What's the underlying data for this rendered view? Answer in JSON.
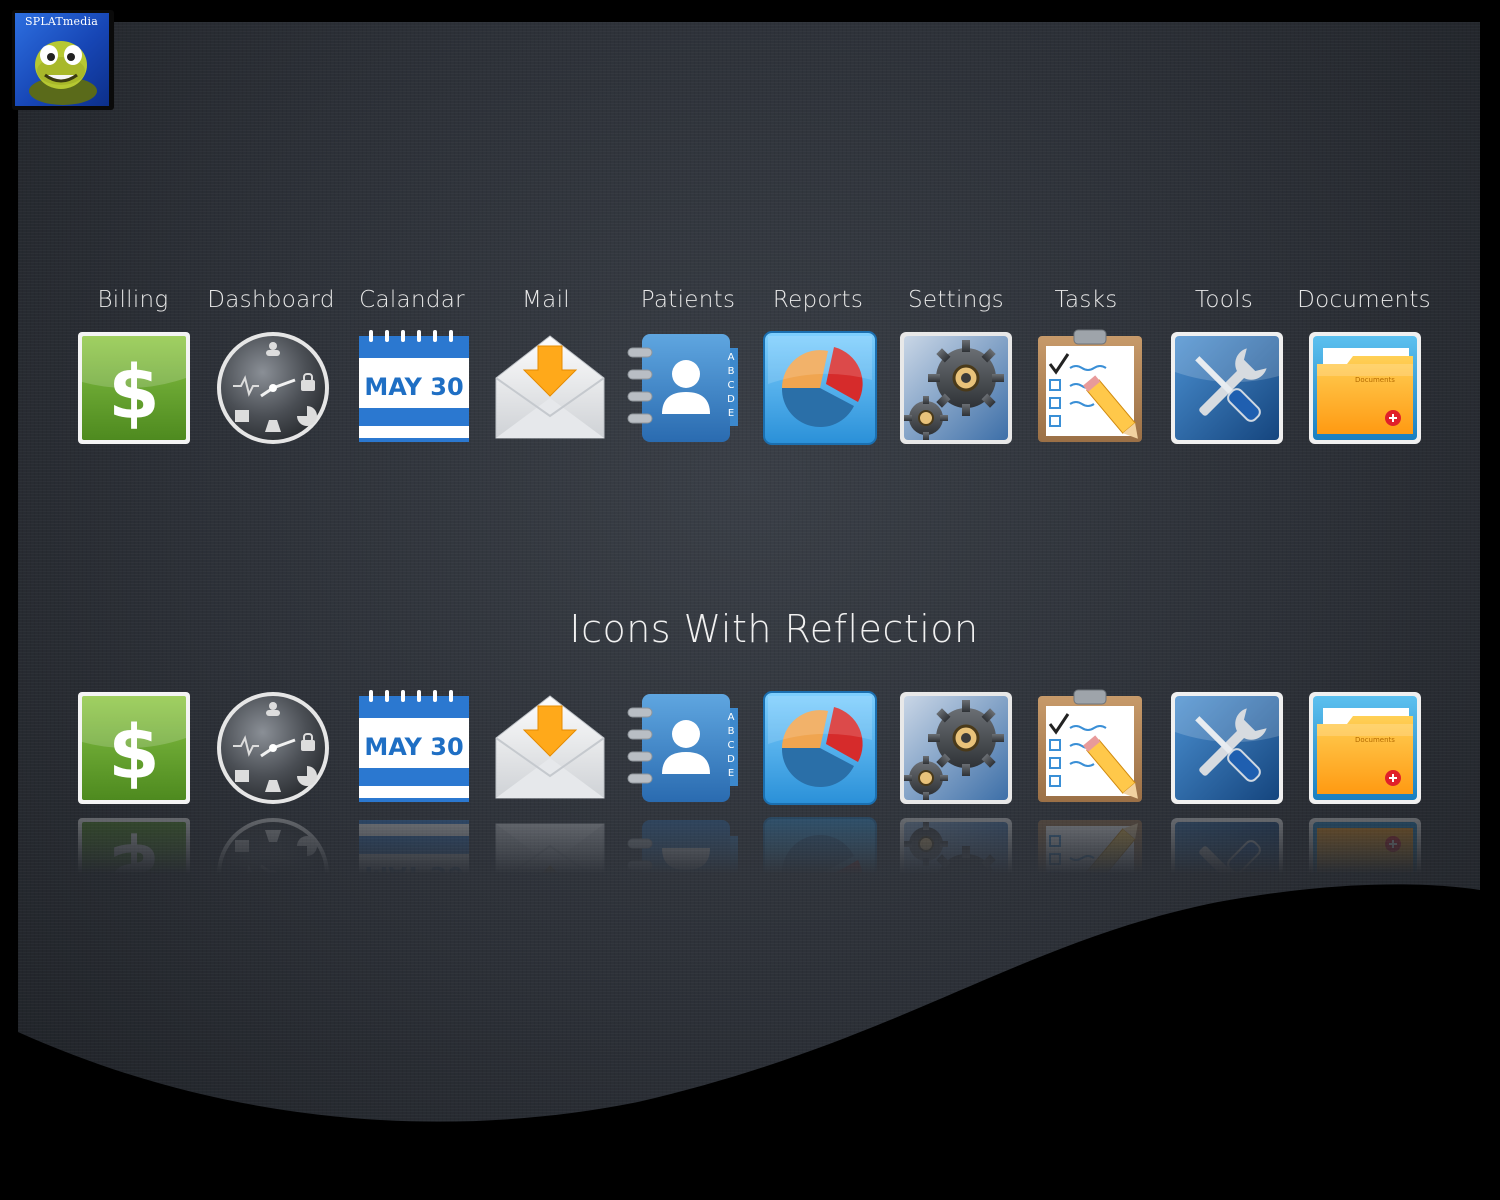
{
  "logo": {
    "text": "SPLATmedia",
    "icon": "turtle-mascot-icon"
  },
  "section_title": "Icons With Reflection",
  "icons": [
    {
      "label": "Billing",
      "icon": "dollar-icon"
    },
    {
      "label": "Dashboard",
      "icon": "clock-dashboard-icon"
    },
    {
      "label": "Calandar",
      "icon": "calendar-icon",
      "date": "MAY 30"
    },
    {
      "label": "Mail",
      "icon": "mail-icon"
    },
    {
      "label": "Patients",
      "icon": "address-book-icon",
      "tabs": [
        "A",
        "B",
        "C",
        "D",
        "E"
      ]
    },
    {
      "label": "Reports",
      "icon": "pie-chart-icon"
    },
    {
      "label": "Settings",
      "icon": "gears-icon"
    },
    {
      "label": "Tasks",
      "icon": "clipboard-icon"
    },
    {
      "label": "Tools",
      "icon": "tools-icon"
    },
    {
      "label": "Documents",
      "icon": "folder-icon",
      "folder_label": "Documents"
    }
  ],
  "colors": {
    "billing_green": "#6aa632",
    "calendar_blue": "#1f6fc4",
    "reports_blue": "#3fa8e6",
    "folder_orange": "#ffa21a",
    "background": "#2c3037"
  }
}
